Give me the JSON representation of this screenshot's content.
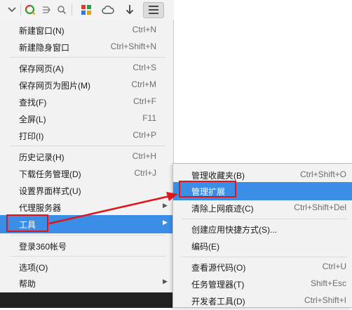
{
  "toolbar": {
    "icons": [
      "chevron-down-icon",
      "qihoo-search-icon",
      "scan-icon",
      "search-icon",
      "app-grid-icon",
      "cloud-icon",
      "download-icon",
      "menu-icon"
    ]
  },
  "main_menu": {
    "items": [
      {
        "label": "新建窗口(N)",
        "shortcut": "Ctrl+N"
      },
      {
        "label": "新建隐身窗口",
        "shortcut": "Ctrl+Shift+N"
      },
      {
        "label": "保存网页(A)",
        "shortcut": "Ctrl+S"
      },
      {
        "label": "保存网页为图片(M)",
        "shortcut": "Ctrl+M"
      },
      {
        "label": "查找(F)",
        "shortcut": "Ctrl+F"
      },
      {
        "label": "全屏(L)",
        "shortcut": "F11"
      },
      {
        "label": "打印(I)",
        "shortcut": "Ctrl+P"
      },
      {
        "label": "历史记录(H)",
        "shortcut": "Ctrl+H"
      },
      {
        "label": "下载任务管理(D)",
        "shortcut": "Ctrl+J"
      },
      {
        "label": "设置界面样式(U)",
        "shortcut": ""
      },
      {
        "label": "代理服务器",
        "shortcut": ""
      },
      {
        "label": "工具",
        "shortcut": ""
      },
      {
        "label": "登录360帐号",
        "shortcut": ""
      },
      {
        "label": "选项(O)",
        "shortcut": ""
      },
      {
        "label": "帮助",
        "shortcut": ""
      }
    ]
  },
  "sub_menu": {
    "items": [
      {
        "label": "管理收藏夹(B)",
        "shortcut": "Ctrl+Shift+O"
      },
      {
        "label": "管理扩展",
        "shortcut": ""
      },
      {
        "label": "清除上网痕迹(C)",
        "shortcut": "Ctrl+Shift+Del"
      },
      {
        "label": "创建应用快捷方式(S)...",
        "shortcut": ""
      },
      {
        "label": "编码(E)",
        "shortcut": ""
      },
      {
        "label": "查看源代码(O)",
        "shortcut": "Ctrl+U"
      },
      {
        "label": "任务管理器(T)",
        "shortcut": "Shift+Esc"
      },
      {
        "label": "开发者工具(D)",
        "shortcut": "Ctrl+Shift+I"
      }
    ]
  },
  "colors": {
    "highlight": "#3a8ee6",
    "annotation_red": "#e0141b",
    "menu_bg": "#f2f2f2"
  }
}
